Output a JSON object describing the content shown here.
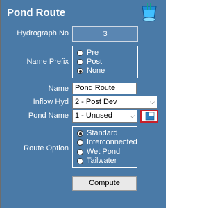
{
  "title": "Pond Route",
  "hydrograph": {
    "label": "Hydrograph No",
    "value": "3"
  },
  "name_prefix": {
    "label": "Name Prefix",
    "options": [
      "Pre",
      "Post",
      "None"
    ],
    "selected": "None"
  },
  "name": {
    "label": "Name",
    "value": "Pond Route"
  },
  "inflow_hyd": {
    "label": "Inflow Hyd",
    "value": "2 - Post Dev"
  },
  "pond_name": {
    "label": "Pond Name",
    "value": "1 - Unused"
  },
  "route_option": {
    "label": "Route Option",
    "options": [
      "Standard",
      "Interconnected",
      "Wet Pond",
      "Tailwater"
    ],
    "selected": "Standard"
  },
  "compute_label": "Compute",
  "colors": {
    "panel": "#4a7aa7",
    "highlight_border": "#c8202a"
  },
  "icons": {
    "title_icon": "pond-icon",
    "pond_button_icon": "pond-edit-icon",
    "dropdown": "chevron-down-icon"
  }
}
